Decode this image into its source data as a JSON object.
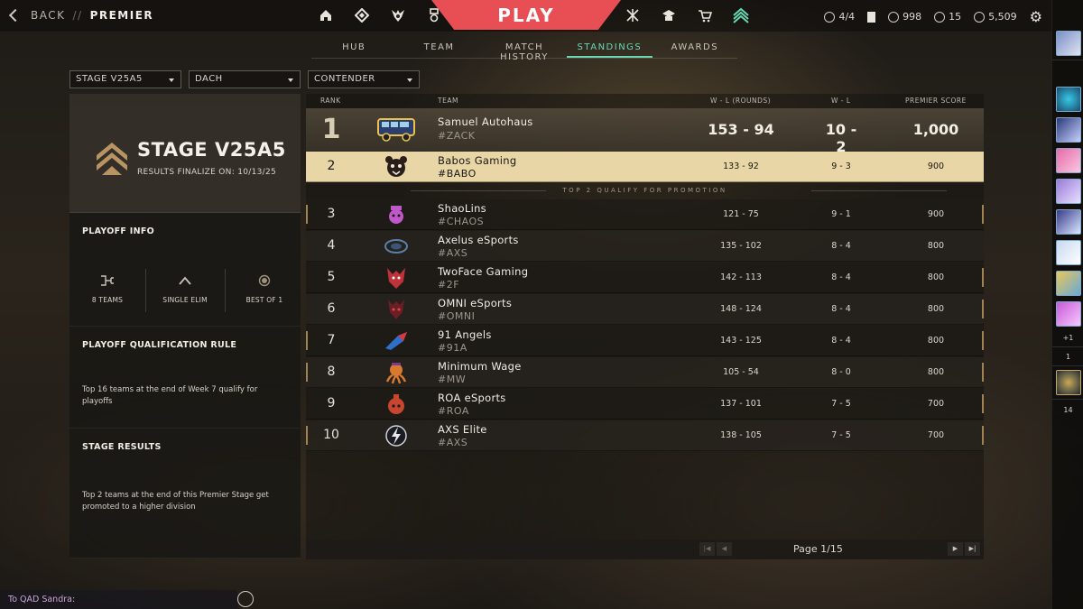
{
  "header": {
    "back_label": "BACK",
    "separator": "//",
    "current_page": "PREMIER",
    "play_label": "PLAY",
    "left_nav_icons": [
      "home-icon",
      "collection-icon",
      "agents-icon",
      "career-icon"
    ],
    "right_nav_icons": [
      "battlepass-icon",
      "agent-contract-icon",
      "store-icon",
      "premier-icon"
    ],
    "tickets": "4/4",
    "vp": "998",
    "radianite": "15",
    "kingdom_credits": "5,509"
  },
  "tabs": [
    "HUB",
    "TEAM",
    "MATCH HISTORY",
    "STANDINGS",
    "AWARDS"
  ],
  "active_tab": "STANDINGS",
  "filters": {
    "stage": "STAGE V25A5",
    "region": "DACH",
    "division": "CONTENDER"
  },
  "stage_card": {
    "title": "STAGE V25A5",
    "finalize": "RESULTS FINALIZE ON: 10/13/25"
  },
  "playoff_info": {
    "title": "PLAYOFF INFO",
    "stats": [
      "8 TEAMS",
      "SINGLE ELIM",
      "BEST OF 1"
    ]
  },
  "qualification": {
    "title": "PLAYOFF QUALIFICATION RULE",
    "body": "Top 16 teams at the end of Week 7 qualify for playoffs"
  },
  "stage_results": {
    "title": "STAGE RESULTS",
    "body_line1": "Top 2 teams at the end of this Premier Stage get",
    "body_line2": "promoted to a higher division"
  },
  "table": {
    "headers": {
      "rank": "RANK",
      "team": "TEAM",
      "wl_rounds": "W - L (ROUNDS)",
      "wl": "W - L",
      "score": "PREMIER SCORE"
    },
    "promo_text": "TOP 2 QUALIFY FOR PROMOTION",
    "rows": [
      {
        "rank": "1",
        "name": "Samuel Autohaus",
        "tag": "#ZACK",
        "wl_rounds": "153 - 94",
        "wl": "10 - 2",
        "score": "1,000",
        "logo": "bus-logo"
      },
      {
        "rank": "2",
        "name": "Babos Gaming",
        "tag": "#BABO",
        "wl_rounds": "133 - 92",
        "wl": "9 - 3",
        "score": "900",
        "logo": "bear-logo"
      },
      {
        "rank": "3",
        "name": "ShaoLins",
        "tag": "#CHAOS",
        "wl_rounds": "121 - 75",
        "wl": "9 - 1",
        "score": "900",
        "logo": "shaolin-logo"
      },
      {
        "rank": "4",
        "name": "Axelus eSports",
        "tag": "#AXS",
        "wl_rounds": "135 - 102",
        "wl": "8 - 4",
        "score": "800",
        "logo": "axelus-logo"
      },
      {
        "rank": "5",
        "name": "TwoFace Gaming",
        "tag": "#2F",
        "wl_rounds": "142 - 113",
        "wl": "8 - 4",
        "score": "800",
        "logo": "twoface-logo"
      },
      {
        "rank": "6",
        "name": "OMNI eSports",
        "tag": "#OMNI",
        "wl_rounds": "148 - 124",
        "wl": "8 - 4",
        "score": "800",
        "logo": "omni-logo"
      },
      {
        "rank": "7",
        "name": "91 Angels",
        "tag": "#91A",
        "wl_rounds": "143 - 125",
        "wl": "8 - 4",
        "score": "800",
        "logo": "angels-logo"
      },
      {
        "rank": "8",
        "name": "Minimum Wage",
        "tag": "#MW",
        "wl_rounds": "105 - 54",
        "wl": "8 - 0",
        "score": "800",
        "logo": "octopus-logo"
      },
      {
        "rank": "9",
        "name": "ROA eSports",
        "tag": "#ROA",
        "wl_rounds": "137 - 101",
        "wl": "7 - 5",
        "score": "700",
        "logo": "roa-logo"
      },
      {
        "rank": "10",
        "name": "AXS Elite",
        "tag": "#AXS",
        "wl_rounds": "138 - 105",
        "wl": "7 - 5",
        "score": "700",
        "logo": "lightning-logo"
      }
    ],
    "page_label": "Page 1/15"
  },
  "social": {
    "more_count": "+1",
    "party_count": "1",
    "friends_count": "14"
  },
  "chat": {
    "placeholder": "To QAD Sandra:"
  },
  "colors": {
    "accent_play": "#e84f55",
    "tab_active": "#68d6b2",
    "highlight_row": "#e9d6a7"
  }
}
